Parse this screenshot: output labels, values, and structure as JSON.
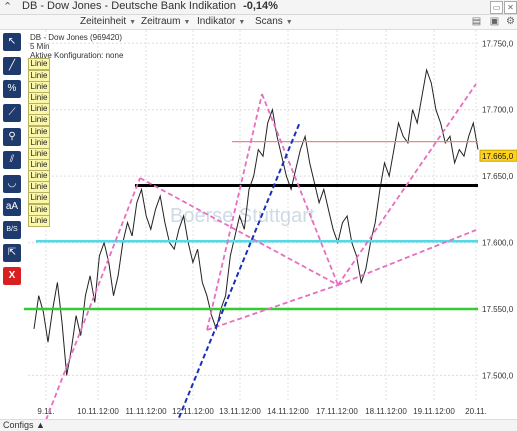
{
  "window": {
    "title": "DB - Dow Jones - Deutsche Bank Indikation",
    "change": "-0,14%",
    "collapse_icon": "chevron-up-down-icon"
  },
  "menu": [
    {
      "label": "Zeiteinheit"
    },
    {
      "label": "Zeitraum"
    },
    {
      "label": "Indikator"
    },
    {
      "label": "Scans"
    }
  ],
  "info": {
    "line1": "DB - Dow Jones (969420)",
    "line2": "5 Min",
    "line3": "Aktive Konfiguration: none"
  },
  "toolbar": [
    {
      "name": "cursor-icon",
      "glyph": "↖"
    },
    {
      "name": "trendline-icon",
      "glyph": "╱"
    },
    {
      "name": "percent-icon",
      "glyph": "%"
    },
    {
      "name": "ray-icon",
      "glyph": "⟋"
    },
    {
      "name": "zoom-icon",
      "glyph": "⚲"
    },
    {
      "name": "channel-icon",
      "glyph": "⫽"
    },
    {
      "name": "arc-icon",
      "glyph": "◡"
    },
    {
      "name": "text-icon",
      "glyph": "aA"
    },
    {
      "name": "buy-sell-icon",
      "glyph": "B/S"
    },
    {
      "name": "measure-icon",
      "glyph": "⇱"
    },
    {
      "name": "delete-icon",
      "glyph": "X"
    }
  ],
  "line_labels": [
    "Linie",
    "Linie",
    "Linie",
    "Linie",
    "Linie",
    "Linie",
    "Linie",
    "Linie",
    "Linie",
    "Linie",
    "Linie",
    "Linie",
    "Linie",
    "Linie",
    "Linie",
    "Linie"
  ],
  "watermark": "Boerse Stuttgart",
  "current_price": "17.665,0",
  "footer": {
    "configs": "Configs"
  },
  "chart_data": {
    "type": "line",
    "ylim": [
      17480,
      17760
    ],
    "y_ticks": [
      "17.750,0",
      "17.700,0",
      "17.650,0",
      "17.600,0",
      "17.550,0",
      "17.500,0"
    ],
    "y_tick_values": [
      17750,
      17700,
      17650,
      17600,
      17550,
      17500
    ],
    "x_ticks": [
      "9.11.",
      "10.11.12:00",
      "11.11.12:00",
      "12.11.12:00",
      "13.11.12:00",
      "14.11.12:00",
      "17.11.12:00",
      "18.11.12:00",
      "19.11.12:00",
      "20.11."
    ],
    "price": [
      17535,
      17560,
      17548,
      17525,
      17550,
      17570,
      17540,
      17500,
      17520,
      17545,
      17530,
      17560,
      17575,
      17555,
      17590,
      17600,
      17585,
      17560,
      17575,
      17600,
      17615,
      17605,
      17630,
      17640,
      17620,
      17610,
      17625,
      17635,
      17615,
      17600,
      17595,
      17610,
      17620,
      17600,
      17585,
      17595,
      17570,
      17560,
      17545,
      17535,
      17550,
      17560,
      17590,
      17605,
      17620,
      17610,
      17640,
      17650,
      17670,
      17665,
      17690,
      17700,
      17680,
      17665,
      17650,
      17640,
      17655,
      17670,
      17680,
      17660,
      17645,
      17630,
      17640,
      17625,
      17610,
      17600,
      17615,
      17620,
      17600,
      17590,
      17570,
      17580,
      17600,
      17615,
      17640,
      17660,
      17650,
      17670,
      17690,
      17680,
      17675,
      17700,
      17690,
      17710,
      17730,
      17720,
      17700,
      17690,
      17675,
      17680,
      17660,
      17670,
      17665,
      17680,
      17690,
      17670
    ],
    "horizontal_lines": [
      {
        "value": 17676,
        "color": "#e48a8a"
      },
      {
        "value": 17643,
        "color": "#000000"
      },
      {
        "value": 17601,
        "color": "#55d8e8"
      },
      {
        "value": 17550,
        "color": "#33cc33"
      }
    ],
    "grid": true
  }
}
